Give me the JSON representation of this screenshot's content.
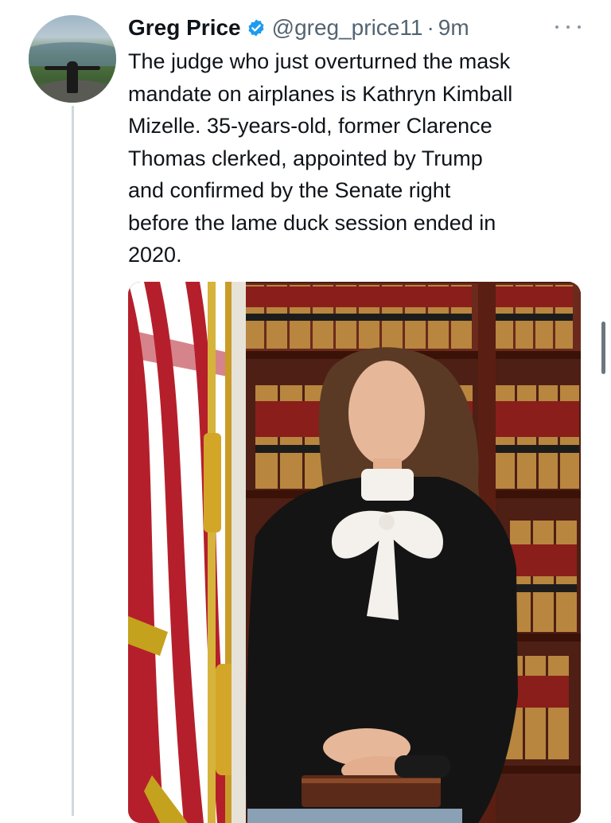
{
  "tweet": {
    "author_name": "Greg Price",
    "handle": "@greg_price11",
    "separator": "·",
    "time": "9m",
    "text": "The judge who just overturned the mask\nmandate on airplanes is Kathryn Kimball\nMizelle. 35-years-old, former Clarence\nThomas clerked, appointed by Trump\nand confirmed by the Senate right\nbefore the lame duck session ended in\n2020.",
    "verified": true,
    "icons": {
      "avatar": "avatar",
      "verified": "verified-badge-icon",
      "more": "more-options-icon"
    }
  },
  "colors": {
    "verified_blue": "#1d9bf0",
    "secondary_text": "#536471",
    "thread_line": "#cfd9de"
  }
}
